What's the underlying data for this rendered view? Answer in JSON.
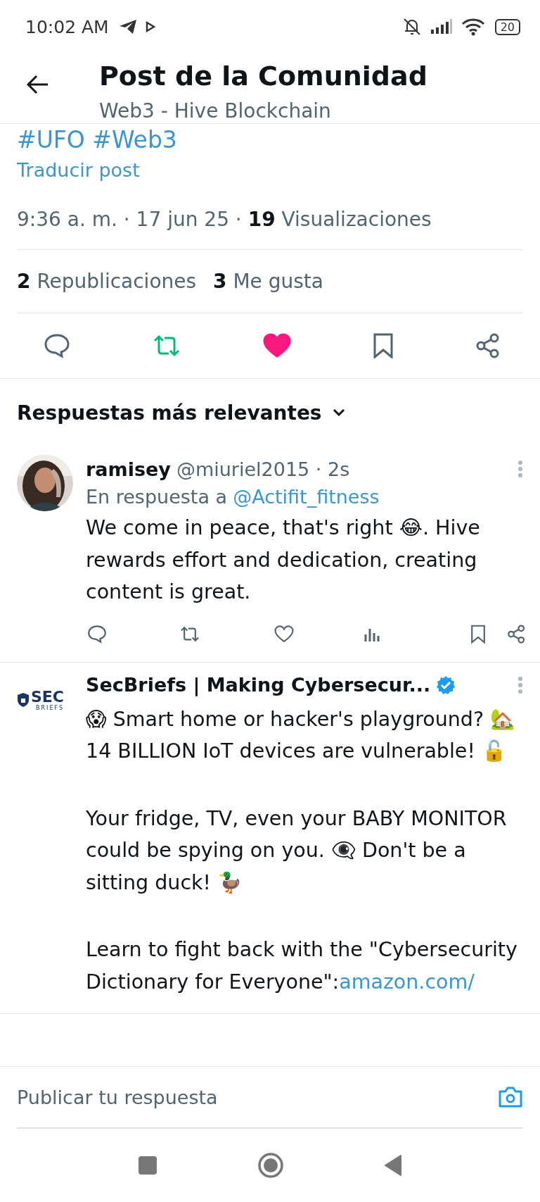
{
  "status_bar": {
    "time": "10:02 AM",
    "battery": "20"
  },
  "header": {
    "title": "Post de la Comunidad",
    "subtitle": "Web3 - Hive Blockchain"
  },
  "post": {
    "hashtags": "#UFO #Web3",
    "translate": "Traducir post",
    "meta": "9:36 a. m. · 17 jun 25 · **19** Visualizaciones",
    "stats": [
      {
        "count": "2",
        "label": "Republicaciones"
      },
      {
        "count": "3",
        "label": "Me gusta"
      }
    ],
    "reposted": true,
    "liked": true,
    "bookmarked": false
  },
  "sort": {
    "label": "Respuestas más relevantes"
  },
  "replies": [
    {
      "avatar": {
        "kind": "picture"
      },
      "name": "ramisey",
      "handle": "@miuriel2015 · 2s",
      "verified": false,
      "reply_prefix": "En respuesta a",
      "reply_to": "@Actifit_fitness",
      "paragraphs": [
        {
          "text": "We come in peace, that's right 😂. Hive rewards effort and dedication, creating content is great."
        }
      ],
      "show_actions": true
    },
    {
      "avatar": {
        "kind": "logo",
        "text": "SEC",
        "subtext": "BRIEFS"
      },
      "name": "SecBriefs | Making Cybersecur...",
      "verified": true,
      "paragraphs": [
        {
          "text": "😱 Smart home or hacker's playground? 🏡  14 BILLION IoT devices are vulnerable! 🔓"
        },
        {
          "text": "Your fridge, TV, even your BABY MONITOR could be spying on you. 👁️‍🗨️ Don't be a sitting duck! 🦆"
        },
        {
          "text": "Learn to fight back with the \"Cybersecurity Dictionary for Everyone\":",
          "link": "amazon.com/"
        }
      ],
      "show_actions": false
    }
  ],
  "composer": {
    "placeholder": "Publicar tu respuesta"
  }
}
